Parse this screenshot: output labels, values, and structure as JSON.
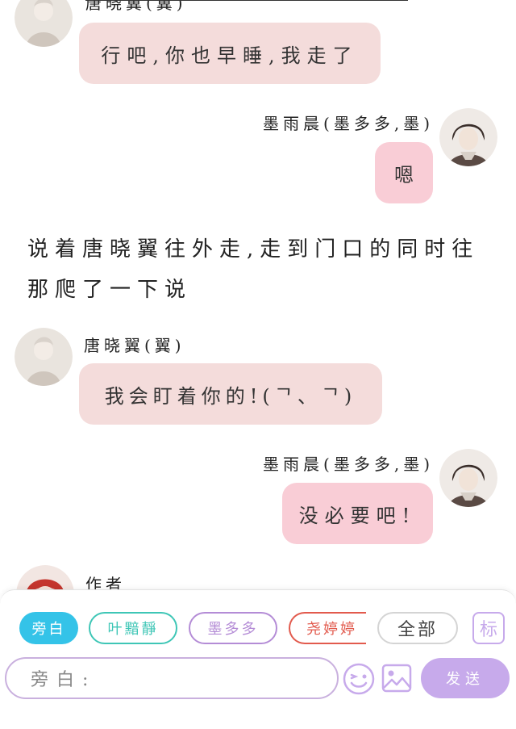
{
  "messages": {
    "m1": {
      "sender": "唐晓翼(翼)",
      "text": "行吧,你也早睡,我走了"
    },
    "m2": {
      "sender": "墨雨晨(墨多多,墨)",
      "text": "嗯"
    },
    "narration": "说着唐晓翼往外走,走到门口的同时往那爬了一下说",
    "m3": {
      "sender": "唐晓翼(翼)",
      "text": "我会盯着你的!(ᄀ、ᄀ)"
    },
    "m4": {
      "sender": "墨雨晨(墨多多,墨)",
      "text": "没必要吧!"
    },
    "m5": {
      "sender": "作者"
    }
  },
  "toolbar": {
    "chips": [
      "旁白",
      "叶黯靜",
      "墨多多",
      "尧婷婷",
      "全部"
    ],
    "flag_label": "标",
    "input_placeholder": "旁白:",
    "send_label": "发送"
  },
  "colors": {
    "chip_selected": "#34c3e8",
    "chip_teal": "#3ec6b6",
    "chip_purple": "#b48cd6",
    "chip_red": "#e25a4d",
    "send": "#c7aaeb",
    "bubble_left": "#f4dcdb",
    "bubble_right": "#f9cdd6"
  }
}
